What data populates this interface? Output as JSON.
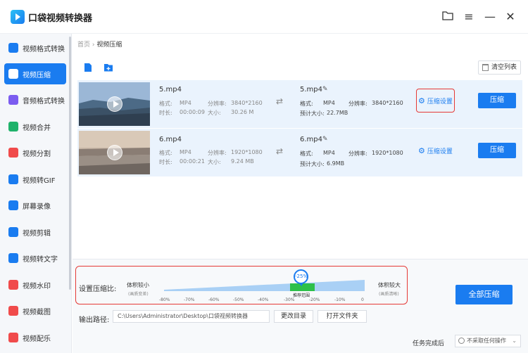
{
  "app": {
    "title": "口袋视频转换器"
  },
  "sidebar": {
    "items": [
      {
        "label": "视频格式转换",
        "color": "#1a7cf0"
      },
      {
        "label": "视频压缩",
        "color": "#ffffff"
      },
      {
        "label": "音频格式转换",
        "color": "#7b5cf0"
      },
      {
        "label": "视频合并",
        "color": "#20b26b"
      },
      {
        "label": "视频分割",
        "color": "#f04b4b"
      },
      {
        "label": "视频转GIF",
        "color": "#1a7cf0"
      },
      {
        "label": "屏幕录像",
        "color": "#1a7cf0"
      },
      {
        "label": "视频剪辑",
        "color": "#1a7cf0"
      },
      {
        "label": "视频转文字",
        "color": "#1a7cf0"
      },
      {
        "label": "视频水印",
        "color": "#f04b4b"
      },
      {
        "label": "视频截图",
        "color": "#f04b4b"
      },
      {
        "label": "视频配乐",
        "color": "#f04b4b"
      }
    ]
  },
  "breadcrumb": {
    "home": "首页",
    "sep": "›",
    "current": "视频压缩"
  },
  "toolbar": {
    "clear": "清空列表"
  },
  "files": [
    {
      "name": "5.mp4",
      "format_label": "格式:",
      "format": "MP4",
      "res_label": "分辨率:",
      "res": "3840*2160",
      "dur_label": "时长:",
      "dur": "00:00:09",
      "size_label": "大小:",
      "size": "30.26 M",
      "out_name": "5.mp4",
      "out_format": "MP4",
      "out_res": "3840*2160",
      "est_label": "预计大小:",
      "est": "22.7MB",
      "settings": "压缩设置",
      "compress": "压缩"
    },
    {
      "name": "6.mp4",
      "format_label": "格式:",
      "format": "MP4",
      "res_label": "分辨率:",
      "res": "1920*1080",
      "dur_label": "时长:",
      "dur": "00:00:21",
      "size_label": "大小:",
      "size": "9.24 MB",
      "out_name": "6.mp4",
      "out_format": "MP4",
      "out_res": "1920*1080",
      "est_label": "预计大小:",
      "est": "6.9MB",
      "settings": "压缩设置",
      "compress": "压缩"
    }
  ],
  "ratio": {
    "label": "设置压缩比:",
    "small": "体积较小",
    "small_sub": "(画质变差)",
    "large": "体积较大",
    "large_sub": "(画质清晰)",
    "recommended": "推荐范围",
    "current": "-25%",
    "ticks": [
      "-80%",
      "-70%",
      "-60%",
      "-50%",
      "-40%",
      "-30%",
      "-20%",
      "-10%",
      "0"
    ]
  },
  "output": {
    "label": "输出路径:",
    "path": "C:\\Users\\Administrator\\Desktop\\口袋视频转换器",
    "change": "更改目录",
    "open": "打开文件夹"
  },
  "all_compress": "全部压缩",
  "after": {
    "label": "任务完成后",
    "value": "不采取任何操作"
  }
}
